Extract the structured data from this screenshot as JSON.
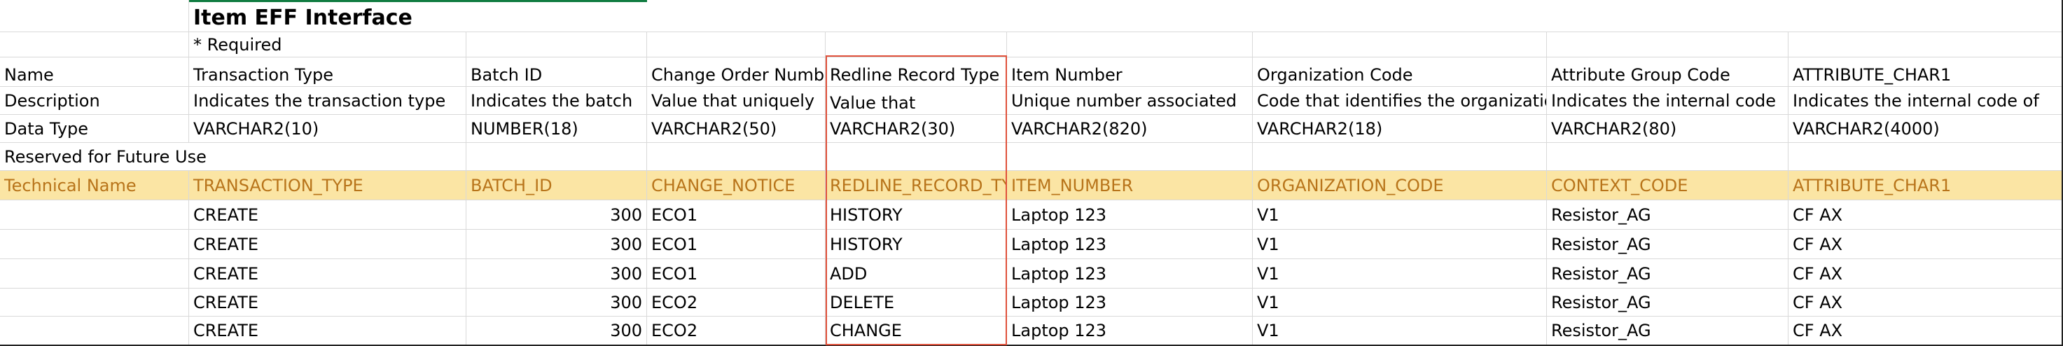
{
  "sheet": {
    "title": "Item EFF Interface",
    "required_note": "* Required",
    "colors": {
      "technical_row_fill": "#fbe5a4",
      "technical_row_text": "#b8741a",
      "highlight_border": "#e0513b",
      "gridline": "#d9d9d9"
    },
    "rows": {
      "name": [
        "Name",
        "Transaction Type",
        "Batch ID",
        "Change Order Number",
        "Redline Record Type",
        "Item Number",
        "Organization Code",
        "Attribute Group Code",
        "ATTRIBUTE_CHAR1"
      ],
      "description": [
        "Description",
        "Indicates the transaction type",
        "Indicates the batch",
        "Value that uniquely",
        "Value that",
        "Unique number associated",
        "Code that identifies the organization",
        "Indicates the internal code",
        "Indicates the internal code of"
      ],
      "data_type": [
        "Data Type",
        "VARCHAR2(10)",
        "NUMBER(18)",
        "VARCHAR2(50)",
        "VARCHAR2(30)",
        "VARCHAR2(820)",
        "VARCHAR2(18)",
        "VARCHAR2(80)",
        "VARCHAR2(4000)"
      ],
      "reserved": [
        "Reserved for Future Use"
      ],
      "technical_name": [
        "Technical Name",
        "TRANSACTION_TYPE",
        "BATCH_ID",
        "CHANGE_NOTICE",
        "REDLINE_RECORD_TYPE",
        "ITEM_NUMBER",
        "ORGANIZATION_CODE",
        "CONTEXT_CODE",
        "ATTRIBUTE_CHAR1"
      ]
    },
    "data_rows": [
      [
        "",
        "CREATE",
        "300",
        "ECO1",
        "HISTORY",
        "Laptop 123",
        "V1",
        "Resistor_AG",
        "CF AX"
      ],
      [
        "",
        "CREATE",
        "300",
        "ECO1",
        "HISTORY",
        "Laptop 123",
        "V1",
        "Resistor_AG",
        "CF AX"
      ],
      [
        "",
        "CREATE",
        "300",
        "ECO1",
        "ADD",
        "Laptop 123",
        "V1",
        "Resistor_AG",
        "CF AX"
      ],
      [
        "",
        "CREATE",
        "300",
        "ECO2",
        "DELETE",
        "Laptop 123",
        "V1",
        "Resistor_AG",
        "CF AX"
      ],
      [
        "",
        "CREATE",
        "300",
        "ECO2",
        "CHANGE",
        "Laptop 123",
        "V1",
        "Resistor_AG",
        "CF AX"
      ]
    ]
  }
}
